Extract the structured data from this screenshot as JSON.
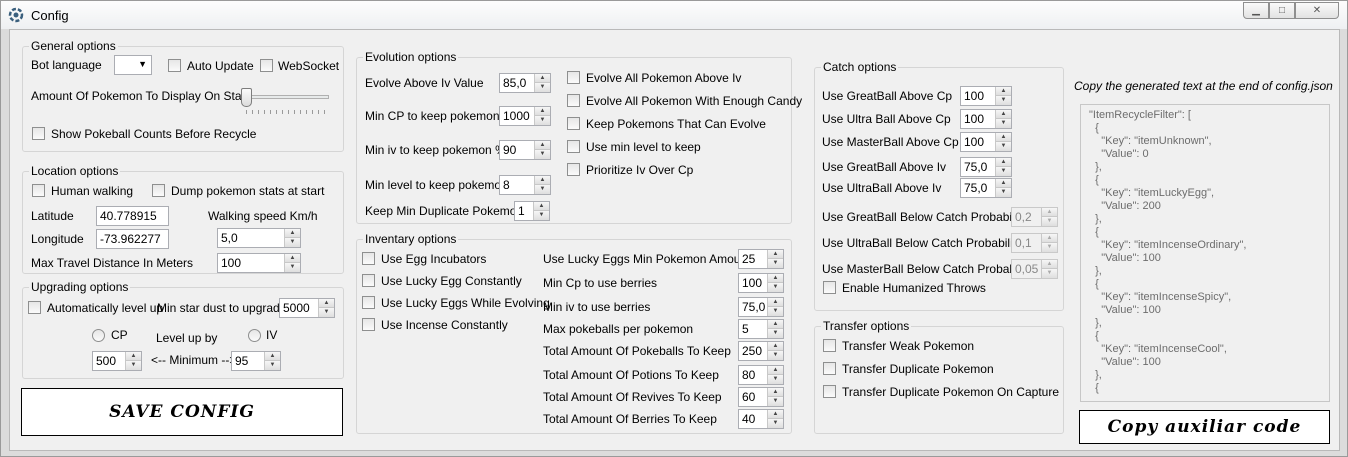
{
  "window": {
    "title": "Config"
  },
  "general": {
    "title": "General options",
    "bot_language_label": "Bot language",
    "bot_language_value": "",
    "auto_update_label": "Auto Update",
    "websocket_label": "WebSocket",
    "amount_display_label": "Amount Of Pokemon To Display On Start",
    "amount_display_level": 0,
    "show_pokeball_label": "Show Pokeball Counts Before Recycle"
  },
  "location": {
    "title": "Location options",
    "human_walking_label": "Human walking",
    "dump_stats_label": "Dump pokemon stats at start",
    "latitude_label": "Latitude",
    "latitude_value": "40.778915",
    "walking_speed_label": "Walking speed Km/h",
    "longitude_label": "Longitude",
    "longitude_value": "-73.962277",
    "walking_speed_value": "5,0",
    "max_travel_label": "Max Travel Distance In Meters",
    "max_travel_value": "100"
  },
  "upgrading": {
    "title": "Upgrading options",
    "auto_level_label": "Automatically level up",
    "min_stardust_label": "Min star dust to upgrade",
    "min_stardust_value": "5000",
    "cp_label": "CP",
    "level_up_by_label": "Level up by",
    "iv_label": "IV",
    "cp_value": "500",
    "minimum_label": "<-- Minimum -->",
    "iv_value": "95"
  },
  "save_button": "SAVE CONFIG",
  "evolution": {
    "title": "Evolution options",
    "fields": [
      {
        "label": "Evolve Above Iv Value",
        "value": "85,0"
      },
      {
        "label": "Min CP to keep pokemon",
        "value": "1000"
      },
      {
        "label": "Min iv to keep pokemon %",
        "value": "90"
      },
      {
        "label": "Min level to keep pokemon",
        "value": "8"
      },
      {
        "label": "Keep Min Duplicate Pokemon",
        "value": "1"
      }
    ],
    "checks": [
      "Evolve All Pokemon Above Iv",
      "Evolve All Pokemon With Enough Candy",
      "Keep Pokemons That Can Evolve",
      "Use min level to keep",
      "Prioritize Iv Over Cp"
    ]
  },
  "inventory": {
    "title": "Inventary options",
    "checks": [
      "Use Egg Incubators",
      "Use Lucky Egg Constantly",
      "Use Lucky Eggs While Evolving",
      "Use Incense Constantly"
    ],
    "fields": [
      {
        "label": "Use Lucky Eggs Min Pokemon Amount",
        "value": "25"
      },
      {
        "label": "Min Cp to use berries",
        "value": "100"
      },
      {
        "label": "Min iv to use berries",
        "value": "75,0"
      },
      {
        "label": "Max pokeballs per pokemon",
        "value": "5"
      },
      {
        "label": "Total Amount Of Pokeballs To Keep",
        "value": "250"
      },
      {
        "label": "Total Amount Of Potions To Keep",
        "value": "80"
      },
      {
        "label": "Total Amount Of Revives To Keep",
        "value": "60"
      },
      {
        "label": "Total Amount Of Berries To Keep",
        "value": "40"
      }
    ]
  },
  "catch": {
    "title": "Catch options",
    "fields": [
      {
        "label": "Use GreatBall Above Cp",
        "value": "100"
      },
      {
        "label": "Use Ultra Ball Above Cp",
        "value": "100"
      },
      {
        "label": "Use MasterBall Above Cp",
        "value": "100"
      },
      {
        "label": "Use GreatBall Above Iv",
        "value": "75,0"
      },
      {
        "label": "Use UltraBall Above Iv",
        "value": "75,0"
      }
    ],
    "prob_fields": [
      {
        "label": "Use GreatBall Below Catch Probability",
        "value": "0,2"
      },
      {
        "label": "Use UltraBall Below Catch Probability",
        "value": "0,1"
      },
      {
        "label": "Use MasterBall Below Catch Probability",
        "value": "0,05"
      }
    ],
    "humanized_label": "Enable Humanized Throws"
  },
  "transfer": {
    "title": "Transfer options",
    "checks": [
      "Transfer Weak Pokemon",
      "Transfer Duplicate Pokemon",
      "Transfer Duplicate Pokemon On Capture"
    ]
  },
  "copy_hint": "Copy the generated text at the end of config.json",
  "code_lines": [
    "\"ItemRecycleFilter\": [",
    "  {",
    "    \"Key\": \"itemUnknown\",",
    "    \"Value\": 0",
    "  },",
    "  {",
    "    \"Key\": \"itemLuckyEgg\",",
    "    \"Value\": 200",
    "  },",
    "  {",
    "    \"Key\": \"itemIncenseOrdinary\",",
    "    \"Value\": 100",
    "  },",
    "  {",
    "    \"Key\": \"itemIncenseSpicy\",",
    "    \"Value\": 100",
    "  },",
    "  {",
    "    \"Key\": \"itemIncenseCool\",",
    "    \"Value\": 100",
    "  },",
    "  {"
  ],
  "copy_button": "Copy auxiliar code"
}
